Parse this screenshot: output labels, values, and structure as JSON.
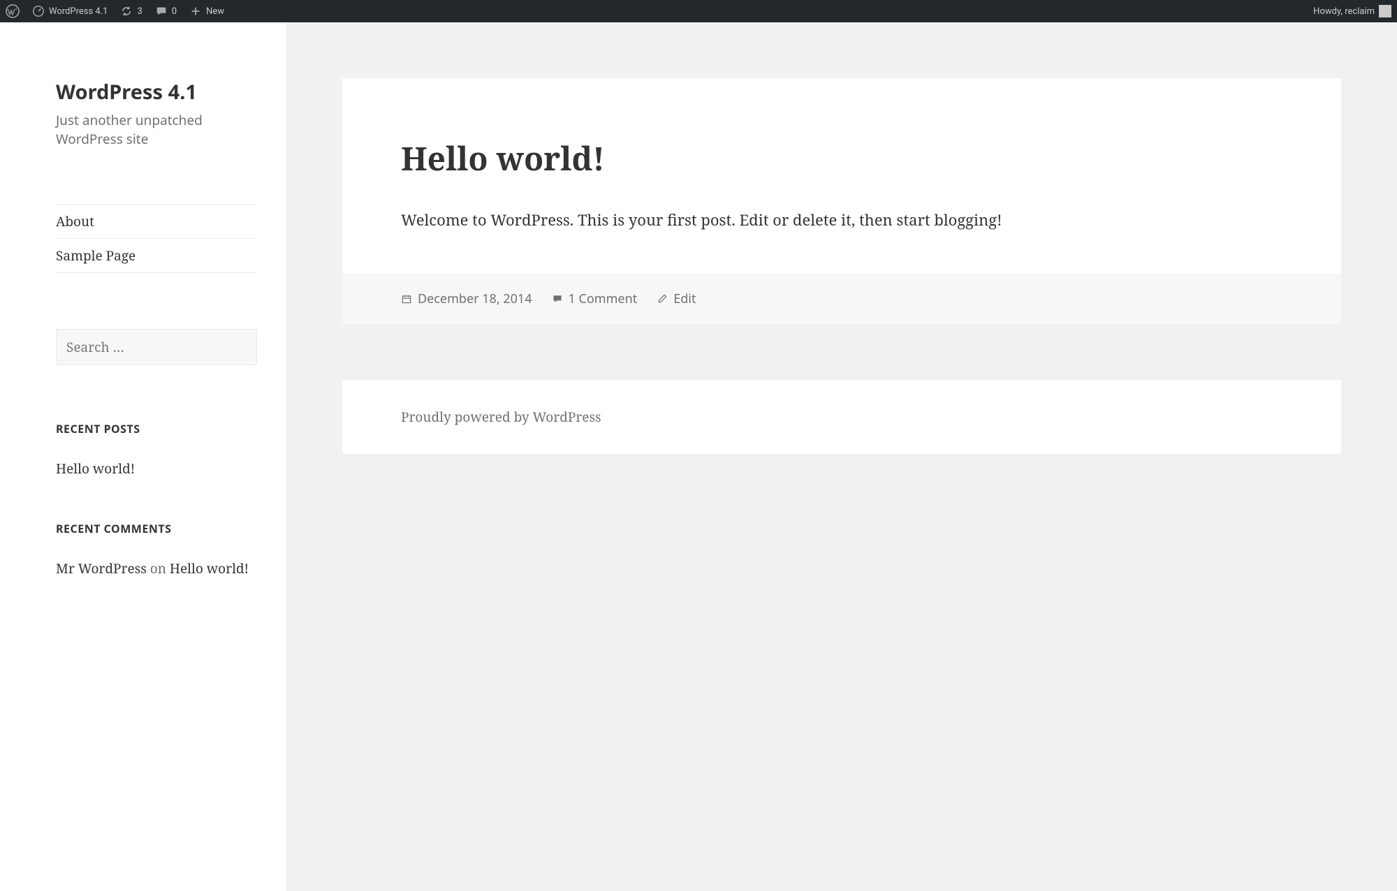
{
  "admin_bar": {
    "site_name": "WordPress 4.1",
    "updates_count": "3",
    "comments_count": "0",
    "new_label": "New",
    "howdy": "Howdy, reclaim"
  },
  "sidebar": {
    "site_title": "WordPress 4.1",
    "tagline": "Just another unpatched WordPress site",
    "nav": [
      {
        "label": "About"
      },
      {
        "label": "Sample Page"
      }
    ],
    "search_placeholder": "Search …",
    "recent_posts_title": "RECENT POSTS",
    "recent_posts": [
      {
        "title": "Hello world!"
      }
    ],
    "recent_comments_title": "RECENT COMMENTS",
    "recent_comments": [
      {
        "author": "Mr WordPress",
        "on": " on ",
        "post": "Hello world!"
      }
    ]
  },
  "post": {
    "title": "Hello world!",
    "content": "Welcome to WordPress. This is your first post. Edit or delete it, then start blogging!",
    "date": "December 18, 2014",
    "comments": "1 Comment",
    "edit": "Edit"
  },
  "footer": {
    "text": "Proudly powered by WordPress"
  }
}
